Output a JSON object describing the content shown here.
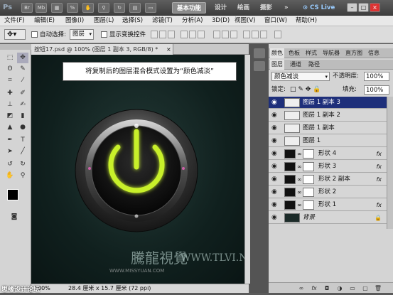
{
  "titlebar": {
    "logo": "Ps",
    "icons": [
      "Br",
      "Mb"
    ],
    "workspaces": [
      "基本功能",
      "设计",
      "绘画",
      "摄影"
    ],
    "more": "»",
    "cslive": "CS Live",
    "win_buttons": [
      "–",
      "□",
      "×"
    ]
  },
  "menubar": {
    "items": [
      "文件(F)",
      "编辑(E)",
      "图像(I)",
      "图层(L)",
      "选择(S)",
      "滤镜(T)",
      "分析(A)",
      "3D(D)",
      "视图(V)",
      "窗口(W)",
      "帮助(H)"
    ]
  },
  "options": {
    "auto_select_label": "自动选择:",
    "auto_select_value": "图层",
    "transform_label": "显示变换控件"
  },
  "document": {
    "tab_label": "按钮17.psd @ 100% (图层 1 副本 3, RGB/8) *",
    "tab_close": "×",
    "zoom": "100%",
    "size": "28.4 厘米 x 15.7 厘米 (72 ppi)"
  },
  "callout": "将复制后的图层混合模式设置为“颜色减淡”",
  "watermark": {
    "text1": "騰龍視覺",
    "text2": "WWW.TLVI.NET",
    "text3": "WWW.MISSYUAN.COM",
    "corner": "思缘设计论坛"
  },
  "panels": {
    "top_tabs": [
      "颜色",
      "色板",
      "样式",
      "导航器",
      "直方图",
      "信息"
    ],
    "layer_tabs": [
      "图层",
      "通道",
      "路径"
    ],
    "blend_mode": "颜色减淡",
    "opacity_label": "不透明度:",
    "opacity_value": "100%",
    "lock_label": "锁定:",
    "fill_label": "填充:",
    "fill_value": "100%"
  },
  "layers": [
    {
      "name": "图层 1 副本 3",
      "selected": true,
      "fx": ""
    },
    {
      "name": "图层 1 副本 2",
      "selected": false,
      "fx": ""
    },
    {
      "name": "图层 1 副本",
      "selected": false,
      "fx": ""
    },
    {
      "name": "图层 1",
      "selected": false,
      "fx": ""
    },
    {
      "name": "形状 4",
      "selected": false,
      "fx": "fx"
    },
    {
      "name": "形状 3",
      "selected": false,
      "fx": "fx"
    },
    {
      "name": "形状 2 副本",
      "selected": false,
      "fx": "fx"
    },
    {
      "name": "形状 2",
      "selected": false,
      "fx": ""
    },
    {
      "name": "形状 1",
      "selected": false,
      "fx": "fx"
    },
    {
      "name": "背景",
      "selected": false,
      "fx": ""
    }
  ],
  "footer_icons": [
    "link-icon",
    "fx-icon",
    "mask-icon",
    "adjustment-icon",
    "folder-icon",
    "new-layer-icon",
    "trash-icon"
  ],
  "colors": {
    "accent": "#1e2f7a",
    "glow": "#c8f02a"
  }
}
